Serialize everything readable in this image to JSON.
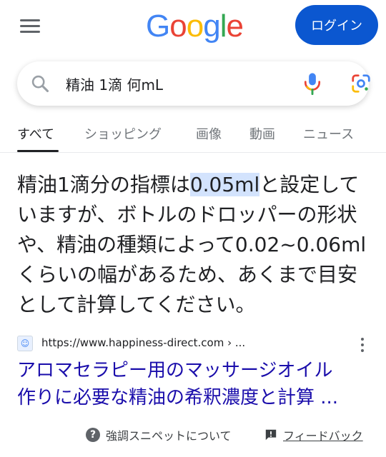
{
  "header": {
    "logo_letters": [
      "G",
      "o",
      "o",
      "g",
      "l",
      "e"
    ],
    "logo_colors": [
      "#4285F4",
      "#EA4335",
      "#FBBC05",
      "#4285F4",
      "#34A853",
      "#EA4335"
    ],
    "login_label": "ログイン"
  },
  "search": {
    "query": "精油 1滴 何mL"
  },
  "tabs": [
    {
      "label": "すべて",
      "active": true
    },
    {
      "label": "ショッピング",
      "active": false
    },
    {
      "label": "画像",
      "active": false
    },
    {
      "label": "動画",
      "active": false
    },
    {
      "label": "ニュース",
      "active": false
    }
  ],
  "snippet": {
    "line1_pre": "精油1滴分の指標は",
    "line1_highlight": "0.05ml",
    "line1_post": "と設定して",
    "line2": "いますが、ボトルのドロッパーの形状",
    "line3": "や、精油の種類によって0.02~0.06ml",
    "line4": "くらいの幅があるため、あくまで目安",
    "line5": "として計算してください。"
  },
  "source": {
    "url": "https://www.happiness-direct.com › ..."
  },
  "result": {
    "title_line1": "アロマセラピー用のマッサージオイル",
    "title_line2": "作りに必要な精油の希釈濃度と計算 ..."
  },
  "footer": {
    "about_label": "強調スニペットについて",
    "feedback_label": "フィードバック"
  },
  "colors": {
    "accent": "#0b57d0",
    "link": "#1a0dab",
    "highlight": "#d3e3fd"
  }
}
